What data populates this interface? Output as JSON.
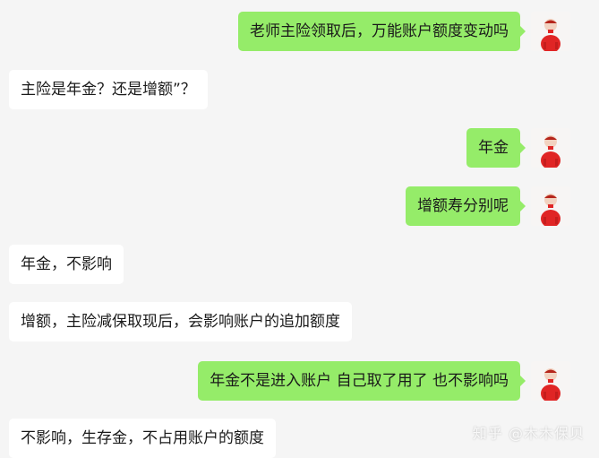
{
  "messages": [
    {
      "side": "right",
      "text": "老师主险领取后，万能账户额度变动吗"
    },
    {
      "side": "left",
      "text": "主险是年金？还是增额”？"
    },
    {
      "side": "right",
      "text": "年金"
    },
    {
      "side": "right",
      "text": "增额寿分别呢"
    },
    {
      "side": "left",
      "text": "年金，不影响"
    },
    {
      "side": "left",
      "text": "增额，主险减保取现后，会影响账户的追加额度"
    },
    {
      "side": "right",
      "text": "年金不是进入账户 自己取了用了 也不影响吗"
    },
    {
      "side": "left",
      "text": "不影响，生存金，不占用账户的额度"
    }
  ],
  "watermark": "知乎 @木木保贝",
  "colors": {
    "background": "#f5f5f5",
    "my_bubble": "#95ec69",
    "other_bubble": "#ffffff"
  },
  "icons": {
    "avatar": "baby-in-red-avatar-icon"
  }
}
